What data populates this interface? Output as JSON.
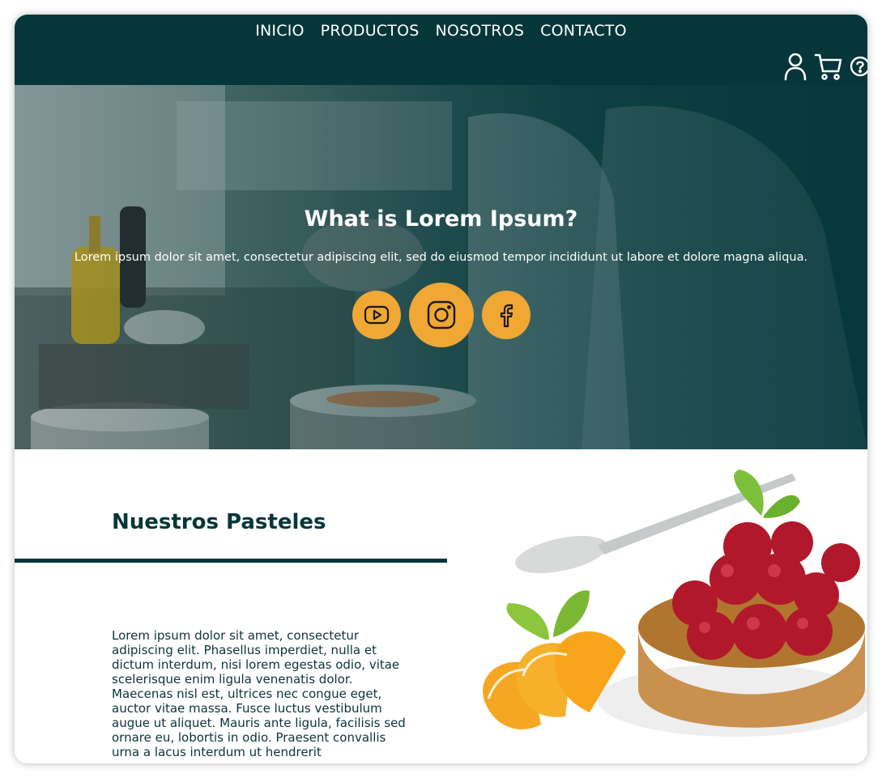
{
  "nav": {
    "items": [
      {
        "label": "INICIO"
      },
      {
        "label": "PRODUCTOS"
      },
      {
        "label": "NOSOTROS"
      },
      {
        "label": "CONTACTO"
      }
    ]
  },
  "header_icons": [
    "user-icon",
    "cart-icon",
    "help-icon"
  ],
  "hero": {
    "title": "What is Lorem Ipsum?",
    "text": "Lorem ipsum dolor sit amet, consectetur adipiscing elit, sed do eiusmod tempor incididunt ut labore et dolore magna aliqua.",
    "social": [
      "youtube-icon",
      "instagram-icon",
      "facebook-icon"
    ]
  },
  "section": {
    "title": "Nuestros Pasteles",
    "text": "Lorem ipsum dolor sit amet, consectetur adipiscing elit. Phasellus imperdiet, nulla et dictum interdum, nisi lorem egestas odio, vitae scelerisque enim ligula venenatis dolor. Maecenas nisl est, ultrices nec congue eget, auctor vitae massa. Fusce luctus vestibulum augue ut aliquet. Mauris ante ligula, facilisis sed ornare eu, lobortis in odio. Praesent convallis urna a lacus interdum ut hendrerit"
  },
  "colors": {
    "header_bg": "#05363a",
    "accent": "#f0a733",
    "heading": "#05363a"
  }
}
